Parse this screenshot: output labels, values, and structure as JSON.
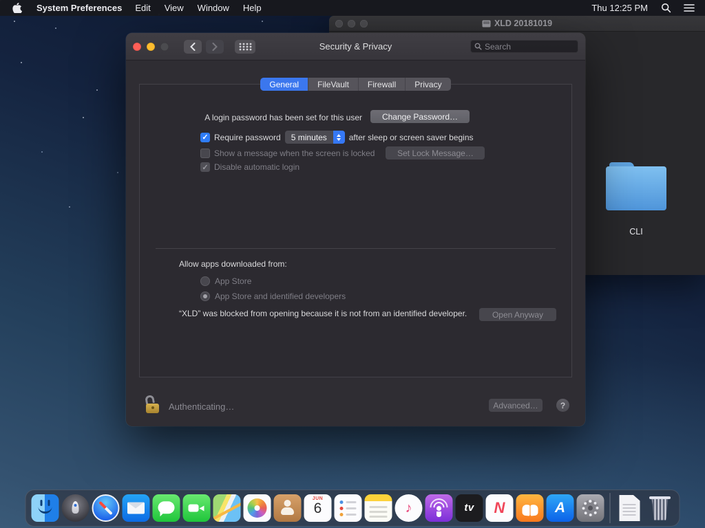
{
  "menu_bar": {
    "app_name": "System Preferences",
    "menus": [
      "Edit",
      "View",
      "Window",
      "Help"
    ],
    "clock": "Thu 12:25 PM",
    "right_icons": [
      "spotlight-search",
      "notification-center"
    ]
  },
  "background_window": {
    "title": "XLD 20181019",
    "folder_label": "CLI"
  },
  "window": {
    "title": "Security & Privacy",
    "search_placeholder": "Search",
    "tabs": [
      "General",
      "FileVault",
      "Firewall",
      "Privacy"
    ],
    "selected_tab": "General",
    "general": {
      "password_set_text": "A login password has been set for this user",
      "change_password_button": "Change Password…",
      "require_password": {
        "label": "Require password",
        "checked": true,
        "interval": "5 minutes",
        "suffix": "after sleep or screen saver begins"
      },
      "show_message": {
        "label": "Show a message when the screen is locked",
        "checked": false,
        "enabled": false
      },
      "set_lock_message_button": "Set Lock Message…",
      "disable_auto_login": {
        "label": "Disable automatic login",
        "checked": true,
        "enabled": false
      },
      "allow_apps_label": "Allow apps downloaded from:",
      "radio_options": [
        {
          "label": "App Store",
          "selected": false
        },
        {
          "label": "App Store and identified developers",
          "selected": true
        }
      ],
      "blocked_text": "“XLD” was blocked from opening because it is not from an identified developer.",
      "open_anyway_button": "Open Anyway"
    },
    "footer": {
      "lock_state": "unlocked",
      "status": "Authenticating…",
      "advanced_button": "Advanced…",
      "help_button": "?"
    }
  },
  "dock": {
    "items": [
      "finder",
      "launchpad",
      "safari",
      "mail",
      "messages",
      "facetime",
      "maps",
      "photos",
      "contacts",
      "calendar",
      "reminders",
      "notes",
      "itunes",
      "podcasts",
      "tv",
      "news",
      "books",
      "app-store",
      "system-preferences",
      "document",
      "trash"
    ],
    "calendar": {
      "month": "JUN",
      "day": "6"
    }
  },
  "colors": {
    "accent_blue": "#3578f6",
    "selected_tab_blue": "#3b77ee",
    "checkbox_blue": "#2f7cf6",
    "traffic_red": "#ff5f57",
    "traffic_yellow": "#febc2e"
  }
}
